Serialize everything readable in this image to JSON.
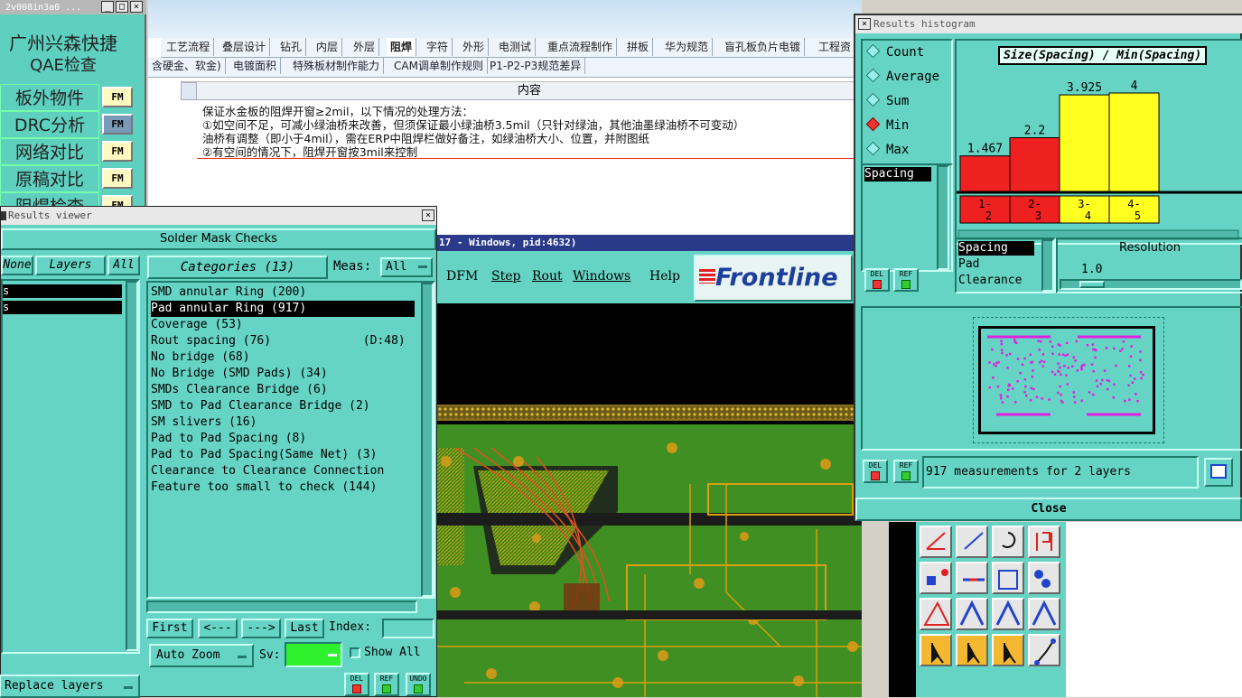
{
  "qae": {
    "title_bar": "2v008in3a0 ...",
    "company": "广州兴森快捷",
    "subtitle": "QAE检查",
    "items": [
      {
        "label": "板外物件",
        "fm": "FM"
      },
      {
        "label": "DRC分析",
        "fm": "FM"
      },
      {
        "label": "网络对比",
        "fm": "FM"
      },
      {
        "label": "原稿对比",
        "fm": "FM"
      },
      {
        "label": "阻焊检查",
        "fm": "FM"
      }
    ]
  },
  "doc": {
    "tabs": [
      "工艺流程",
      "叠层设计",
      "钻孔",
      "内层",
      "外层",
      "阻焊",
      "字符",
      "外形",
      "电测试",
      "重点流程制作",
      "拼板",
      "华为规范",
      "盲孔板负片电镀",
      "工程资"
    ],
    "active_tab": "阻焊",
    "subtabs": [
      "含硬金、软金)",
      "电镀面积",
      "特殊板材制作能力",
      "CAM调单制作规则",
      "P1-P2-P3规范差异"
    ],
    "column_header": "内容",
    "lines": [
      "保证水金板的阻焊开窗≥2mil，以下情况的处理方法：",
      "①如空间不足，可减小绿油桥来改善，但须保证最小绿油桥3.5mil（只针对绿油，其他油墨绿油桥不可变动）",
      "油桥有调整（即小于4mil），需在ERP中阻焊栏做好备注，如绿油桥大小、位置，并附图纸",
      "②有空间的情况下，阻焊开窗按3mil来控制"
    ]
  },
  "viewer": {
    "title": "Results viewer",
    "heading": "Solder Mask Checks",
    "none_btn": "None",
    "layers_btn": "Layers",
    "all_btn": "All",
    "layers": [
      "s",
      "s"
    ],
    "categories_btn": "Categories (13)",
    "meas_label": "Meas:",
    "meas_value": "All",
    "categories": [
      "SMD annular Ring (200)",
      "Pad annular Ring (917)",
      "Coverage (53)",
      "Rout spacing (76)             (D:48)",
      "No bridge (68)",
      "No Bridge (SMD Pads) (34)",
      "SMDs Clearance Bridge (6)",
      "SMD to Pad Clearance Bridge (2)",
      "SM slivers (16)",
      "Pad to Pad Spacing (8)",
      "Pad to Pad Spacing(Same Net) (3)",
      "Clearance to Clearance Connection",
      "Feature too small to check (144)"
    ],
    "selected_index": 1,
    "first": "First",
    "prev": "<---",
    "next": "--->",
    "last": "Last",
    "index_label": "Index:",
    "auto_zoom": "Auto Zoom",
    "sv_label": "Sv:",
    "show_all": "Show All",
    "replace_layers": "Replace layers",
    "del": "DEL",
    "ref": "REF",
    "undo": "UNDO"
  },
  "genesis": {
    "title": "17 - Windows, pid:4632)",
    "menu": [
      "DFM",
      "Step",
      "Rout",
      "Windows",
      "Help"
    ],
    "logo": "Frontline",
    "colors": {
      "board": "#3a8a1e",
      "trace": "#d8a010",
      "pad": "#c89818",
      "red": "#e04020"
    }
  },
  "histogram": {
    "title": "Results histogram",
    "modes": [
      "Count",
      "Average",
      "Sum",
      "Min",
      "Max"
    ],
    "selected_mode": "Min",
    "list_item": "Spacing",
    "chart_title": "Size(Spacing) / Min(Spacing)",
    "resolution_label": "Resolution",
    "resolution_value": "1.0",
    "attrs": [
      "Spacing",
      "Pad",
      "Clearance"
    ],
    "status": "917 measurements for 2 layers",
    "close": "Close",
    "del": "DEL",
    "ref": "REF"
  },
  "chart_data": {
    "type": "bar",
    "title": "Size(Spacing) / Min(Spacing)",
    "categories": [
      "1-2",
      "2-3",
      "3-4",
      "4-5"
    ],
    "values": [
      1.467,
      2.2,
      3.925,
      4
    ],
    "value_labels": [
      "1.467",
      "2.2",
      "3.925",
      "4"
    ],
    "colors": [
      "#ee2020",
      "#ee2020",
      "#ffff20",
      "#ffff20"
    ],
    "ylim": [
      0,
      4.4
    ],
    "grid": false
  }
}
